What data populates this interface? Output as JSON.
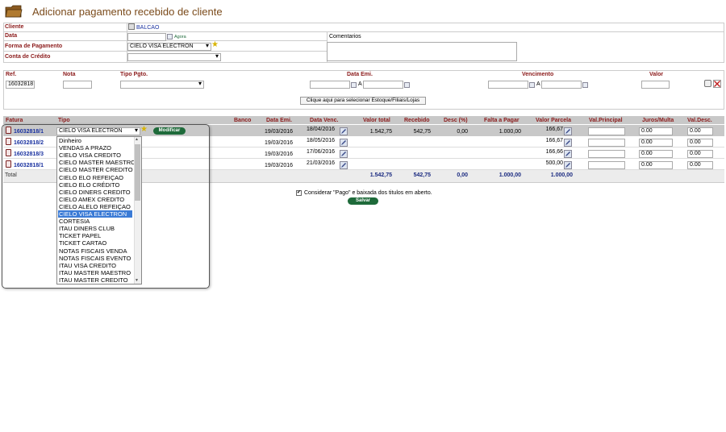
{
  "page": {
    "title": "Adicionar pagamento recebido de cliente",
    "accent": "#8b1a1a"
  },
  "form": {
    "cliente_label": "Cliente",
    "cliente_value": "BALCAO",
    "data_label": "Data",
    "data_value": "",
    "agora": "Agora",
    "comentarios_label": "Comentarios",
    "forma_label": "Forma de Pagamento",
    "forma_value": "CIELO VISA ELECTRON",
    "conta_label": "Conta de Crédito",
    "conta_value": ""
  },
  "filters": {
    "ref_label": "Ref.",
    "ref_value": "16032818",
    "nota_label": "Nota",
    "tipo_label": "Tipo Pgto.",
    "data_emi_label": "Data Emi.",
    "a1": "A",
    "venc_label": "Vencimento",
    "a2": "A",
    "valor_label": "Valor",
    "select_button": "Clique aqui para selecionar Estoque/Filiais/Lojas"
  },
  "table": {
    "headers": {
      "fatura": "Fatura",
      "tipo": "Tipo",
      "banco": "Banco",
      "data_emi": "Data Emi.",
      "data_venc": "Data Venc.",
      "valor_total": "Valor total",
      "recebido": "Recebido",
      "desc": "Desc (%)",
      "falta": "Falta a Pagar",
      "valor_parcela": "Valor Parcela",
      "val_principal": "Val.Principal",
      "juros": "Juros/Multa",
      "val_desc": "Val.Desc."
    },
    "tipo_select_value": "CIELO VISA ELECTRON",
    "modificar": "Modificar",
    "rows": [
      {
        "fatura": "16032818/1",
        "data_emi": "19/03/2016",
        "data_venc": "18/04/2016",
        "valor_total": "1.542,75",
        "recebido": "542,75",
        "desc": "0,00",
        "falta": "1.000,00",
        "valor_parcela": "166,67",
        "juros": "0.00",
        "val_desc": "0.00"
      },
      {
        "fatura": "16032818/2",
        "data_emi": "19/03/2016",
        "data_venc": "18/05/2016",
        "valor_total": "",
        "recebido": "",
        "desc": "",
        "falta": "",
        "valor_parcela": "166,67",
        "juros": "0.00",
        "val_desc": "0.00"
      },
      {
        "fatura": "16032818/3",
        "data_emi": "19/03/2016",
        "data_venc": "17/06/2016",
        "valor_total": "",
        "recebido": "",
        "desc": "",
        "falta": "",
        "valor_parcela": "166,66",
        "juros": "0.00",
        "val_desc": "0.00"
      },
      {
        "fatura": "16032818/1",
        "data_emi": "19/03/2016",
        "data_venc": "21/03/2016",
        "valor_total": "",
        "recebido": "",
        "desc": "",
        "falta": "",
        "valor_parcela": "500,00",
        "juros": "0.00",
        "val_desc": "0.00"
      }
    ],
    "total_row": {
      "label": "Total",
      "valor_total": "1.542,75",
      "recebido": "542,75",
      "desc": "0,00",
      "falta": "1.000,00",
      "valor_parcela": "1.000,00"
    }
  },
  "dropdown_options": [
    "Dinheiro",
    "VENDAS A PRAZO",
    "CIELO VISA CREDITO",
    "CIELO MASTER MAESTRO",
    "CIELO MASTER CREDITO",
    "CIELO ELO REFEIÇAO",
    "CIELO ELO CRÉDITO",
    "CIELO DINERS CREDITO",
    "CIELO AMEX CREDITO",
    "CIELO ALELO REFEIÇAO",
    "CIELO VISA ELECTRON",
    "CORTESIA",
    "ITAU DINERS CLUB",
    "TICKET PAPEL",
    "TICKET CARTAO",
    "NOTAS FISCAIS VENDA",
    "NOTAS FISCAIS EVENTO",
    "ITAU VISA CREDITO",
    "ITAU MASTER MAESTRO",
    "ITAU MASTER CREDITO"
  ],
  "dropdown_selected_index": 10,
  "footer": {
    "considerar": "Considerar \"Pago\" e baixada dos titulos em aberto.",
    "salvar": "Salvar"
  }
}
